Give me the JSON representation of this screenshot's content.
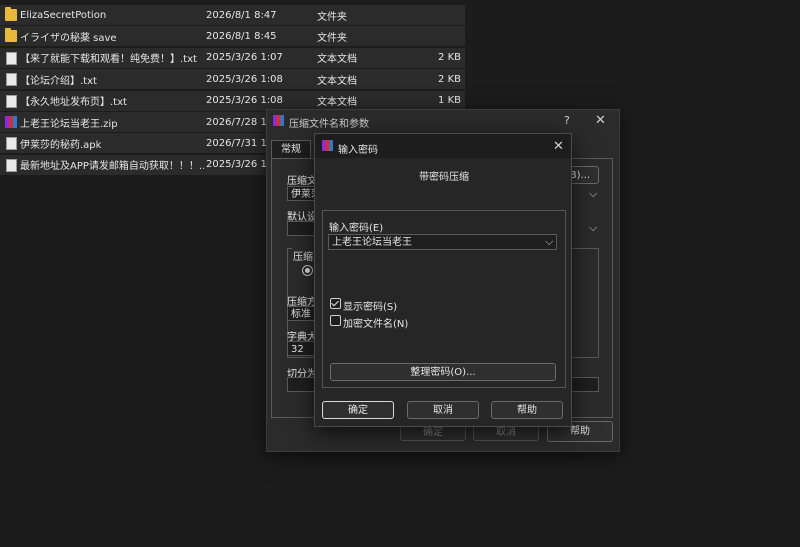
{
  "files": [
    {
      "name": "ElizaSecretPotion",
      "date": "2026/8/1 8:47",
      "type": "文件夹",
      "size": "",
      "icon": "folder-icon"
    },
    {
      "name": "イライザの秘薬 save",
      "date": "2026/8/1 8:45",
      "type": "文件夹",
      "size": "",
      "icon": "folder-icon"
    },
    {
      "name": "【来了就能下载和观看！纯免费！】.txt",
      "date": "2025/3/26 1:07",
      "type": "文本文档",
      "size": "2 KB",
      "icon": "text-file-icon"
    },
    {
      "name": "【论坛介绍】.txt",
      "date": "2025/3/26 1:08",
      "type": "文本文档",
      "size": "2 KB",
      "icon": "text-file-icon"
    },
    {
      "name": "【永久地址发布页】.txt",
      "date": "2025/3/26 1:08",
      "type": "文本文档",
      "size": "1 KB",
      "icon": "text-file-icon"
    },
    {
      "name": "上老王论坛当老王.zip",
      "date": "2026/7/28 1:5",
      "type": "",
      "size": "",
      "icon": "archive-icon"
    },
    {
      "name": "伊莱莎的秘药.apk",
      "date": "2026/7/31 19:",
      "type": "",
      "size": "",
      "icon": "file-icon"
    },
    {
      "name": "最新地址及APP请发邮箱自动获取！！！...",
      "date": "2025/3/26 1:0",
      "type": "",
      "size": "",
      "icon": "text-file-icon"
    }
  ],
  "archive_dialog": {
    "title": "压缩文件名和参数",
    "help_mark": "?",
    "tab_general": "常规",
    "label_filename": "压缩文",
    "filename_value": "伊莱莎",
    "browse_label": "(B)...",
    "label_default": "默认设",
    "label_format": "压缩",
    "label_method": "压缩方",
    "method_value": "标准",
    "label_dict": "字典大",
    "dict_value": "32",
    "label_split": "切分为",
    "ok": "确定",
    "cancel": "取消",
    "help": "帮助"
  },
  "password_dialog": {
    "title": "输入密码",
    "heading": "带密码压缩",
    "label_password": "输入密码(E)",
    "password_value": "上老王论坛当老王",
    "show_password": "显示密码(S)",
    "show_password_checked": true,
    "encrypt_names": "加密文件名(N)",
    "encrypt_names_checked": false,
    "organize": "整理密码(O)...",
    "ok": "确定",
    "cancel": "取消",
    "help": "帮助"
  },
  "colors": {
    "background": "#1c1c1c",
    "row": "#2b2b2b",
    "folder": "#e8b93a"
  }
}
